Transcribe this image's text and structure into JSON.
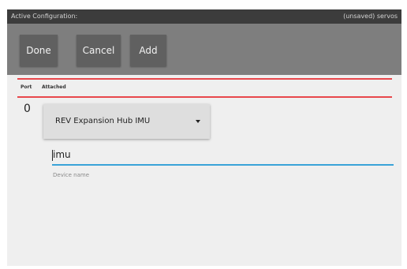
{
  "window": {
    "title": "Active Configuration:",
    "status": "(unsaved) servos"
  },
  "toolbar": {
    "done_label": "Done",
    "cancel_label": "Cancel",
    "add_label": "Add"
  },
  "table": {
    "columns": [
      "Port",
      "Attached"
    ],
    "rows": [
      {
        "port": "0",
        "device_type": "REV Expansion Hub IMU",
        "device_name": "imu",
        "device_name_hint": "Device name"
      }
    ]
  },
  "colors": {
    "toolbar_bg": "#7e7e7e",
    "button_bg": "#606060",
    "divider_red": "#e8474b",
    "input_underline": "#3aa3d8"
  },
  "icons": [
    "dropdown-caret-icon"
  ]
}
